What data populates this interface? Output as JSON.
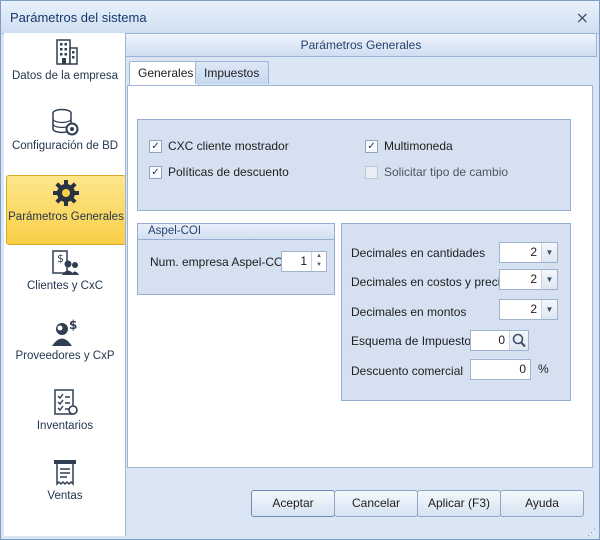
{
  "window": {
    "title": "Parámetros del sistema",
    "close_glyph": "⨯"
  },
  "sidebar": {
    "items": [
      {
        "label": "Datos de la empresa",
        "icon": "building-icon"
      },
      {
        "label": "Configuración de BD",
        "icon": "database-gear-icon"
      },
      {
        "label": "Parámetros Generales",
        "icon": "gear-icon",
        "active": true
      },
      {
        "label": "Clientes y CxC",
        "icon": "clients-money-icon"
      },
      {
        "label": "Proveedores y CxP",
        "icon": "provider-money-icon"
      },
      {
        "label": "Inventarios",
        "icon": "checklist-icon"
      },
      {
        "label": "Ventas",
        "icon": "receipt-icon"
      }
    ]
  },
  "panel": {
    "title": "Parámetros Generales"
  },
  "tabs": [
    {
      "label": "Generales",
      "active": true
    },
    {
      "label": "Impuestos",
      "active": false
    }
  ],
  "options": {
    "cxc_cliente_mostrador": {
      "label": "CXC cliente mostrador",
      "checked": true,
      "check_glyph": "✓"
    },
    "politicas_descuento": {
      "label": "Políticas de descuento",
      "checked": true,
      "check_glyph": "✓"
    },
    "multimoneda": {
      "label": "Multimoneda",
      "checked": true,
      "check_glyph": "✓"
    },
    "solicitar_tipo_cambio": {
      "label": "Solicitar tipo de cambio",
      "checked": false,
      "enabled": false
    }
  },
  "aspel_coi": {
    "title": "Aspel-COI",
    "num_empresa_label": "Num. empresa Aspel-COI",
    "num_empresa_value": "1"
  },
  "decimals": {
    "cantidades_label": "Decimales en cantidades",
    "cantidades_value": "2",
    "costos_label": "Decimales en costos y precios",
    "costos_value": "2",
    "montos_label": "Decimales en montos",
    "montos_value": "2",
    "esquema_label": "Esquema de Impuesto",
    "esquema_value": "0",
    "descuento_label": "Descuento comercial",
    "descuento_value": "0",
    "percent_sign": "%"
  },
  "buttons": {
    "aceptar": "Aceptar",
    "cancelar": "Cancelar",
    "aplicar": "Aplicar (F3)",
    "ayuda": "Ayuda"
  },
  "colors": {
    "accent_active": "#f9cf48",
    "panel_bg": "#d5e1f1",
    "title_text": "#15386b"
  }
}
